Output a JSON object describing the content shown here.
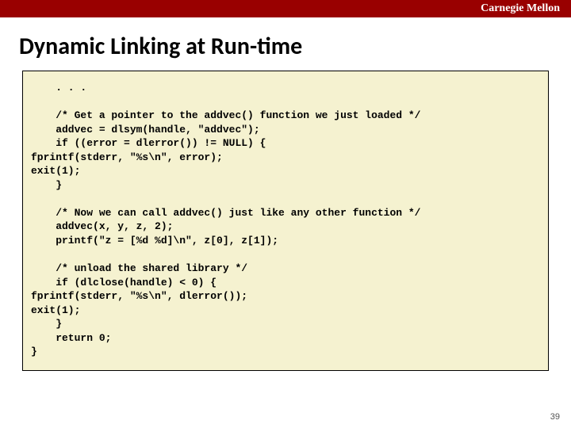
{
  "header": {
    "brand": "Carnegie Mellon"
  },
  "title": "Dynamic Linking at Run-time",
  "code": "    . . .\n\n    /* Get a pointer to the addvec() function we just loaded */\n    addvec = dlsym(handle, \"addvec\");\n    if ((error = dlerror()) != NULL) {\nfprintf(stderr, \"%s\\n\", error);\nexit(1);\n    }\n\n    /* Now we can call addvec() just like any other function */\n    addvec(x, y, z, 2);\n    printf(\"z = [%d %d]\\n\", z[0], z[1]);\n\n    /* unload the shared library */\n    if (dlclose(handle) < 0) {\nfprintf(stderr, \"%s\\n\", dlerror());\nexit(1);\n    }\n    return 0;\n}",
  "pagenum": "39"
}
